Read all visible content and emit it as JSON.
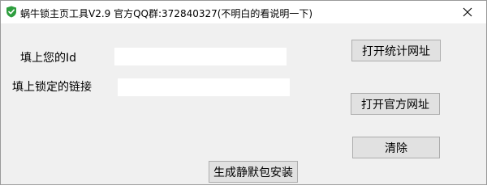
{
  "window": {
    "title": "蜗牛锁主页工具V2.9 官方QQ群:372840327(不明白的看说明一下)",
    "app_icon": "shield-check-icon",
    "close_icon": "close-icon"
  },
  "form": {
    "id_label": "填上您的Id",
    "id_value": "",
    "link_label": "填上锁定的链接",
    "link_value": ""
  },
  "buttons": {
    "open_stats_url": "打开统计网址",
    "open_official_url": "打开官方网址",
    "clear": "清除",
    "generate_silent_package": "生成静默包安装"
  },
  "colors": {
    "window_bg": "#f0f0f0",
    "button_bg": "#e1e1e1",
    "button_border": "#adadad",
    "icon_green": "#2e9e3e"
  }
}
